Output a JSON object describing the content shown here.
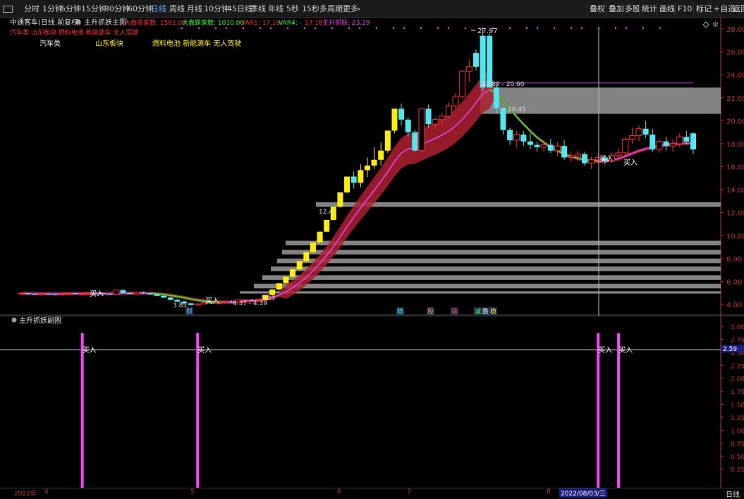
{
  "toolbar": {
    "timeframes": [
      "分时",
      "1分钟",
      "5分钟",
      "15分钟",
      "30分钟",
      "60分钟",
      "日线",
      "周线",
      "月线",
      "10分钟",
      "45日线",
      "季线",
      "年线",
      "5秒",
      "15秒",
      "多周期",
      "更多"
    ],
    "active_timeframe": "日线",
    "right_buttons": [
      "叠权",
      "叠加",
      "多股",
      "统计",
      "画线",
      "F10",
      "标记",
      "+自选",
      "返回"
    ]
  },
  "main_header": {
    "stock_label": "中通客车(日线,前复权)",
    "indicator_name": "主升抓妖主图",
    "values": [
      {
        "text": "大盘涨家数: 1581.00",
        "color": "#ff3030"
      },
      {
        "text": "大盘跌家数: 1010.00",
        "color": "#30ff30"
      },
      {
        "text": "VAR1: 17.18",
        "color": "#ff3030"
      },
      {
        "text": "VAR4: -",
        "color": "#30ff30"
      },
      {
        "text": "17.18",
        "color": "#ff3030"
      },
      {
        "text": "主升抓妖: 23.29",
        "color": "#ff40ff"
      }
    ],
    "concept_tags": "汽车类 山东板块 燃料电池 新能源车 无人驾驶",
    "labels": [
      "汽车类",
      "山东板块",
      "燃料电池 新能源车 无人驾驶"
    ]
  },
  "main_axis": {
    "ticks": [
      "28.00",
      "26.00",
      "24.00",
      "22.00",
      "20.00",
      "18.00",
      "16.00",
      "14.00",
      "12.00",
      "10.00",
      "8.00",
      "6.00",
      "4.00"
    ],
    "tick_values": [
      28,
      26,
      24,
      22,
      20,
      18,
      16,
      14,
      12,
      10,
      8,
      6,
      4
    ]
  },
  "annotations": {
    "high": "27.97",
    "band_label": "22.89 - 20.60",
    "band_label2": "20.45",
    "low1": "3.85",
    "low2": "4.37 - 4.39",
    "low3": "5.03",
    "level_12": "12.4",
    "buy": "买入",
    "markers": [
      {
        "text": "财",
        "color": "#6ab0ff"
      },
      {
        "text": "稳",
        "color": "#40e0e0"
      },
      {
        "text": "股",
        "color": "#ff9030"
      },
      {
        "text": "咏",
        "color": "#ff4040"
      },
      {
        "text": "减",
        "color": "#40ff40"
      },
      {
        "text": "跌",
        "color": "#ffffff"
      },
      {
        "text": "稳",
        "color": "#ffe040"
      }
    ]
  },
  "sub_header": {
    "indicator_name": "主升抓妖副图"
  },
  "sub_axis": {
    "ticks": [
      "3.00",
      "2.75",
      "2.50",
      "2.25",
      "2.00",
      "1.75",
      "1.50",
      "1.25",
      "1.00",
      "0.75",
      "0.50",
      "0.25"
    ],
    "tick_values": [
      3.0,
      2.75,
      2.5,
      2.25,
      2.0,
      1.75,
      1.5,
      1.25,
      1.0,
      0.75,
      0.5,
      0.25
    ],
    "current_label": "2.59",
    "signal_label": "买入"
  },
  "bottom_axis": {
    "year": "2022年",
    "months": [
      "4",
      "5",
      "6",
      "7",
      "8"
    ],
    "cursor_date": "2022/08/03/三",
    "period_button": "日线"
  },
  "colors": {
    "up": "#ff3030",
    "down": "#50e8f0",
    "yellow": "#ffee00",
    "magenta": "#ff40ff",
    "band": "#9a9a9a",
    "ribbon": "#b02030",
    "axis": "#c03030"
  },
  "chart_data": {
    "type": "candlestick",
    "ylim": [
      3.4,
      28.8
    ],
    "candles": [
      [
        4.95,
        5.0,
        4.9,
        4.98
      ],
      [
        4.98,
        5.0,
        4.88,
        4.92
      ],
      [
        4.92,
        4.96,
        4.86,
        4.9
      ],
      [
        4.9,
        4.95,
        4.85,
        4.93
      ],
      [
        4.93,
        4.98,
        4.88,
        4.9
      ],
      [
        4.9,
        4.94,
        4.85,
        4.88
      ],
      [
        4.88,
        4.95,
        4.82,
        4.92
      ],
      [
        4.92,
        5.0,
        4.9,
        4.98
      ],
      [
        4.98,
        5.02,
        4.92,
        4.94
      ],
      [
        4.94,
        4.98,
        4.88,
        4.95
      ],
      [
        4.95,
        5.05,
        4.92,
        5.02
      ],
      [
        5.02,
        5.08,
        4.95,
        4.98
      ],
      [
        4.98,
        5.02,
        4.9,
        4.93
      ],
      [
        4.93,
        4.96,
        4.85,
        4.88
      ],
      [
        4.88,
        5.3,
        4.85,
        5.25
      ],
      [
        5.25,
        5.35,
        4.95,
        5.0
      ],
      [
        5.0,
        5.05,
        4.88,
        4.92
      ],
      [
        4.92,
        5.1,
        4.9,
        5.05
      ],
      [
        5.05,
        5.12,
        4.92,
        4.98
      ],
      [
        4.98,
        5.02,
        4.85,
        4.88
      ],
      [
        4.88,
        4.92,
        4.7,
        4.75
      ],
      [
        4.75,
        4.8,
        4.55,
        4.6
      ],
      [
        4.6,
        4.65,
        4.35,
        4.4
      ],
      [
        4.4,
        4.5,
        4.2,
        4.25
      ],
      [
        4.25,
        4.35,
        4.05,
        4.1
      ],
      [
        4.1,
        4.15,
        3.9,
        3.95
      ],
      [
        3.95,
        4.1,
        3.85,
        4.05
      ],
      [
        4.05,
        4.2,
        4.0,
        4.15
      ],
      [
        4.15,
        4.25,
        4.05,
        4.1
      ],
      [
        4.1,
        4.2,
        4.0,
        4.18
      ],
      [
        4.18,
        4.3,
        4.1,
        4.25
      ],
      [
        4.25,
        4.35,
        4.15,
        4.2
      ],
      [
        4.2,
        4.42,
        4.18,
        4.38
      ],
      [
        4.38,
        4.45,
        4.3,
        4.4
      ],
      [
        4.4,
        4.45,
        4.3,
        4.36
      ],
      [
        4.36,
        4.42,
        4.3,
        4.39
      ],
      [
        4.39,
        4.83,
        4.37,
        4.83
      ],
      [
        4.83,
        5.31,
        4.8,
        5.31
      ],
      [
        5.31,
        5.84,
        5.25,
        5.84
      ],
      [
        5.84,
        6.42,
        5.8,
        6.42
      ],
      [
        6.42,
        7.06,
        6.4,
        7.06
      ],
      [
        7.06,
        7.77,
        7.0,
        7.77
      ],
      [
        7.77,
        8.55,
        7.7,
        8.55
      ],
      [
        8.55,
        9.4,
        8.5,
        9.4
      ],
      [
        9.4,
        10.34,
        9.35,
        10.34
      ],
      [
        10.34,
        11.37,
        10.3,
        11.37
      ],
      [
        11.37,
        12.51,
        11.3,
        12.51
      ],
      [
        12.51,
        13.76,
        12.45,
        13.76
      ],
      [
        13.76,
        15.14,
        13.7,
        15.14
      ],
      [
        15.14,
        15.6,
        14.1,
        14.6
      ],
      [
        14.6,
        16.2,
        14.2,
        15.7
      ],
      [
        15.7,
        16.8,
        15.1,
        16.1
      ],
      [
        16.1,
        17.7,
        15.8,
        16.6
      ],
      [
        16.6,
        18.1,
        16.1,
        17.4
      ],
      [
        17.4,
        19.14,
        17.2,
        19.14
      ],
      [
        19.14,
        21.05,
        18.9,
        21.05
      ],
      [
        21.05,
        21.5,
        19.6,
        20.1
      ],
      [
        20.1,
        20.3,
        18.6,
        19.0
      ],
      [
        19.0,
        19.2,
        17.3,
        17.4
      ],
      [
        17.4,
        21.05,
        17.3,
        21.05
      ],
      [
        21.05,
        21.4,
        19.4,
        19.7
      ],
      [
        19.7,
        20.3,
        19.3,
        20.1
      ],
      [
        20.1,
        20.7,
        19.6,
        20.4
      ],
      [
        20.4,
        21.6,
        20.2,
        21.3
      ],
      [
        21.3,
        22.4,
        20.9,
        22.1
      ],
      [
        22.1,
        24.31,
        21.9,
        24.31
      ],
      [
        24.31,
        25.3,
        23.4,
        24.7
      ],
      [
        24.7,
        26.2,
        24.4,
        25.9
      ],
      [
        22.89,
        27.97,
        22.6,
        27.4
      ],
      [
        27.4,
        27.6,
        22.89,
        22.89
      ],
      [
        22.9,
        23.2,
        20.6,
        21.1
      ],
      [
        21.1,
        21.2,
        18.8,
        19.2
      ],
      [
        19.2,
        19.4,
        17.9,
        18.3
      ],
      [
        18.3,
        19.1,
        17.7,
        18.8
      ],
      [
        18.8,
        19.1,
        17.8,
        18.2
      ],
      [
        18.2,
        18.9,
        17.5,
        17.9
      ],
      [
        17.9,
        18.2,
        17.3,
        17.7
      ],
      [
        17.7,
        18.3,
        17.3,
        17.9
      ],
      [
        17.9,
        18.4,
        17.2,
        17.4
      ],
      [
        17.4,
        18.1,
        16.9,
        17.8
      ],
      [
        17.8,
        18.3,
        16.6,
        16.8
      ],
      [
        16.8,
        17.3,
        16.4,
        16.9
      ],
      [
        16.9,
        17.4,
        16.5,
        17.1
      ],
      [
        17.1,
        17.3,
        16.1,
        16.3
      ],
      [
        16.3,
        16.9,
        15.8,
        16.6
      ],
      [
        16.6,
        17.2,
        16.3,
        16.8
      ],
      [
        16.8,
        17.0,
        16.2,
        16.5
      ],
      [
        16.5,
        17.2,
        16.4,
        17.0
      ],
      [
        17.0,
        17.6,
        16.5,
        17.2
      ],
      [
        17.2,
        18.6,
        17.0,
        18.4
      ],
      [
        18.4,
        19.4,
        18.0,
        18.7
      ],
      [
        18.7,
        19.6,
        18.2,
        19.3
      ],
      [
        19.3,
        20.0,
        18.5,
        18.8
      ],
      [
        18.8,
        19.3,
        17.3,
        17.5
      ],
      [
        17.5,
        18.4,
        17.2,
        18.2
      ],
      [
        18.2,
        18.6,
        17.4,
        17.8
      ],
      [
        17.8,
        18.4,
        17.3,
        18.0
      ],
      [
        18.0,
        18.9,
        17.7,
        18.6
      ],
      [
        18.6,
        19.1,
        17.9,
        18.2
      ],
      [
        18.9,
        19.0,
        17.1,
        17.5
      ]
    ],
    "series": [
      {
        "values": [
          4.95,
          4.95,
          4.94,
          4.94,
          4.93,
          4.93,
          4.93,
          4.94,
          4.94,
          4.95,
          4.95,
          4.95,
          4.95,
          4.94,
          4.96,
          4.98,
          4.98,
          4.98,
          4.98,
          4.97,
          4.93,
          4.87,
          4.79,
          4.7,
          4.6,
          4.48,
          4.38,
          4.3,
          4.24,
          4.21,
          4.2,
          4.21,
          4.24,
          4.28,
          4.32,
          4.36,
          4.45,
          4.6,
          4.82,
          5.1,
          5.45,
          5.88,
          6.38,
          6.95,
          7.58,
          8.28,
          9.05,
          9.88,
          10.78,
          11.6,
          12.4,
          13.18,
          13.95,
          14.72,
          15.55,
          16.45,
          17.18,
          17.55,
          17.6,
          17.9,
          18.2,
          18.45,
          18.75,
          19.1,
          19.55,
          20.15,
          20.82,
          21.55,
          22.35,
          22.7,
          22.4,
          21.8,
          21.05,
          20.35,
          19.7,
          19.1,
          18.55,
          18.1,
          17.72,
          17.4,
          17.1,
          16.88,
          16.72,
          16.6,
          16.52,
          16.48,
          16.48,
          16.55,
          16.7,
          16.92,
          17.15,
          17.38,
          17.55,
          17.7,
          17.8,
          17.88,
          17.95,
          18.02,
          18.05,
          18.05
        ]
      }
    ],
    "buy_signals": [
      9,
      26,
      85,
      88
    ],
    "sub_ylim": [
      0,
      3.2
    ]
  }
}
